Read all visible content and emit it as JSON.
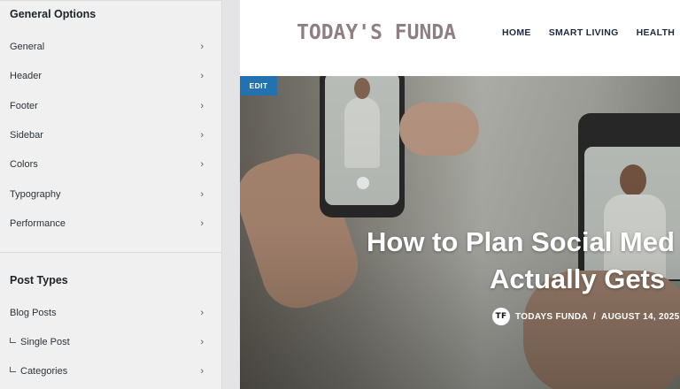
{
  "sidebar": {
    "general": {
      "title": "General Options",
      "items": [
        "General",
        "Header",
        "Footer",
        "Sidebar",
        "Colors",
        "Typography",
        "Performance"
      ]
    },
    "post_types": {
      "title": "Post Types",
      "items": [
        {
          "label": "Blog Posts",
          "sub": false
        },
        {
          "label": "Single Post",
          "sub": true
        },
        {
          "label": "Categories",
          "sub": true
        }
      ]
    }
  },
  "preview": {
    "logo": "TODAY'S FUNDA",
    "nav": [
      "HOME",
      "SMART LIVING",
      "HEALTH"
    ],
    "edit_label": "EDIT",
    "headline_line1": "How to Plan Social Med",
    "headline_line2": "Actually Gets",
    "author_initials": "TF",
    "author": "TODAYS FUNDA",
    "separator": "/",
    "date": "AUGUST 14, 2025"
  },
  "colors": {
    "edit_badge": "#2271b1",
    "logo": "#8f7f83",
    "nav": "#1d2b3f"
  }
}
